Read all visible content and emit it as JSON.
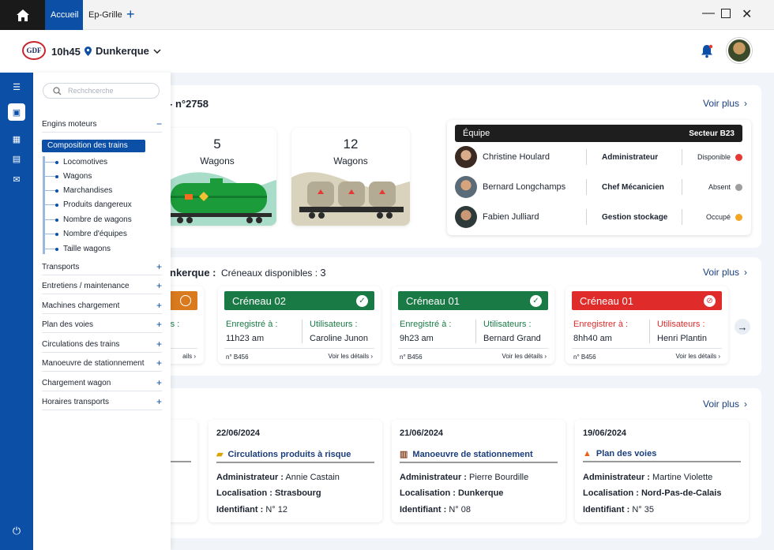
{
  "titlebar": {
    "tabs": [
      "Accueil",
      "Ep-Grille"
    ],
    "add": "+",
    "minimize": "—",
    "close": "✕"
  },
  "header": {
    "logo": "GDF",
    "time": "10h45",
    "location": "Dunkerque"
  },
  "drawer": {
    "search_placeholder": "Rechchcerche",
    "open_section": "Engins moteurs",
    "active_item": "Composition des trains",
    "sub_items": [
      "Locomotives",
      "Wagons",
      "Marchandises",
      "Produits dangereux",
      "Nombre de wagons",
      "Nombre d'équipes",
      "Taille wagons"
    ],
    "sections": [
      "Transports",
      "Entretiens / maintenance",
      "Machines chargement",
      "Plan des voies",
      "Circulations des trains",
      "Manoeuvre de stationnement",
      "Chargement wagon",
      "Horaires transports"
    ]
  },
  "train": {
    "title": "rt - n°2758",
    "voir_plus": "Voir plus",
    "wagons": [
      {
        "count": "5",
        "label": "Wagons"
      },
      {
        "count": "12",
        "label": "Wagons"
      }
    ]
  },
  "equipe": {
    "title": "Équipe",
    "sector": "Secteur B23",
    "members": [
      {
        "name": "Christine Houlard",
        "role": "Administrateur",
        "status": "Disponible",
        "status_color": "#e53935"
      },
      {
        "name": "Bernard Longchamps",
        "role": "Chef Mécanicien",
        "status": "Absent",
        "status_color": "#9e9e9e"
      },
      {
        "name": "Fabien Julliard",
        "role": "Gestion stockage",
        "status": "Occupé",
        "status_color": "#f4a623"
      }
    ]
  },
  "creneaux": {
    "title": "nkerque :",
    "available_label": "Créneaux disponibles :",
    "available_count": "3",
    "voir_plus": "Voir plus",
    "partial": {
      "user_label": "rs :",
      "details": "ails"
    },
    "cards": [
      {
        "title": "Créneau 02",
        "color": "#197a45",
        "label_left": "Enregistré à :",
        "value_left": "11h23 am",
        "label_right": "Utilisateurs :",
        "value_right": "Caroline Junon",
        "id": "n° B456",
        "details": "Voir les détails"
      },
      {
        "title": "Créneau 01",
        "color": "#197a45",
        "label_left": "Enregistré à :",
        "value_left": "9h23 am",
        "label_right": "Utilisateurs :",
        "value_right": "Bernard Grand",
        "id": "n° B456",
        "details": "Voir les détails"
      },
      {
        "title": "Créneau 01",
        "color": "#e02b2b",
        "label_left": "Enregistrer à :",
        "value_left": "8hh40 am",
        "label_right": "Utilisateurs :",
        "value_right": "Henri Plantin",
        "id": "n° B456",
        "details": "Voir les détails"
      }
    ]
  },
  "events": {
    "voir_plus": "Voir plus",
    "cards": [
      {
        "date": "22/06/2024",
        "type": "Circulations produits à risque",
        "admin_label": "Administrateur :",
        "admin": "Annie Castain",
        "loc_label": "Localisation :",
        "loc": "Strasbourg",
        "id_label": "Identifiant :",
        "id": "N° 12"
      },
      {
        "date": "21/06/2024",
        "type": "Manoeuvre de stationnement",
        "admin_label": "Administrateur :",
        "admin": "Pierre Bourdille",
        "loc_label": "Localisation :",
        "loc": "Dunkerque",
        "id_label": "Identifiant :",
        "id": "N° 08"
      },
      {
        "date": "19/06/2024",
        "type": "Plan des voies",
        "admin_label": "Administrateur :",
        "admin": "Martine Violette",
        "loc_label": "Localisation :",
        "loc": "Nord-Pas-de-Calais",
        "id_label": "Identifiant :",
        "id": "N° 35"
      }
    ]
  }
}
